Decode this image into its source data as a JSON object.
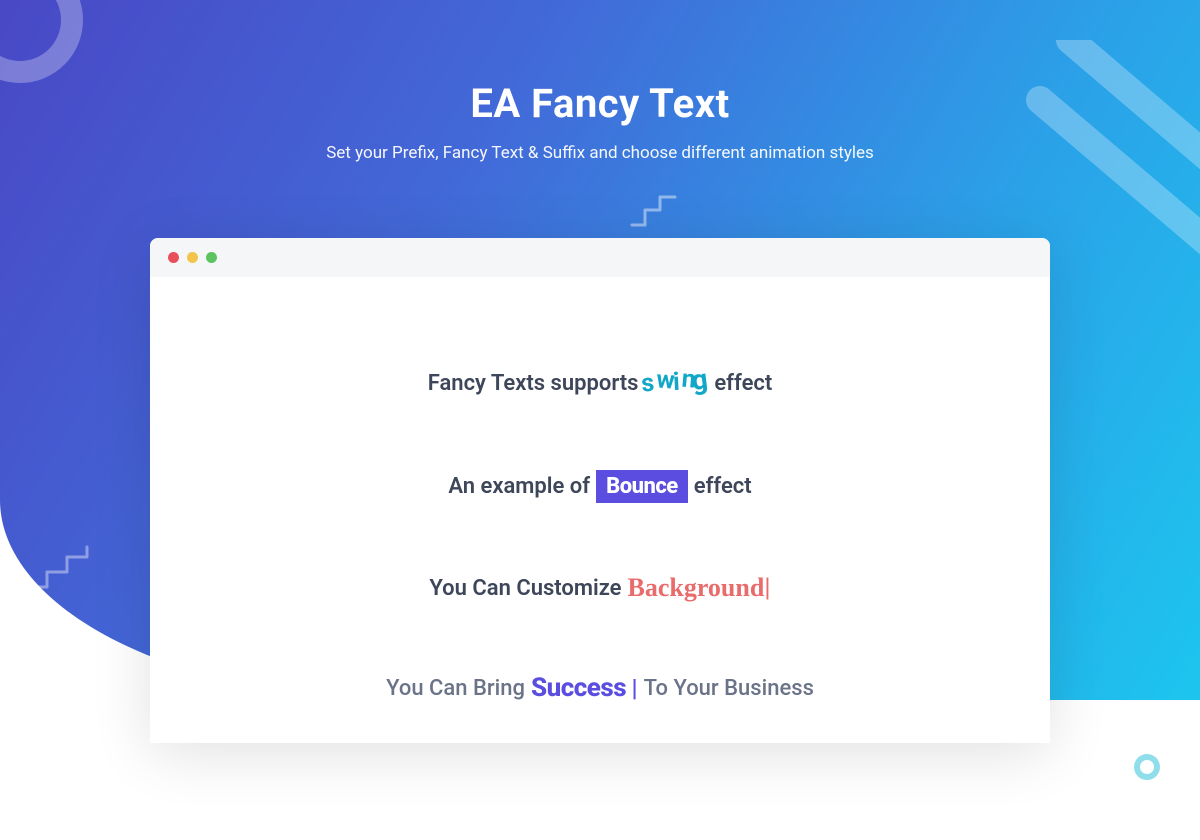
{
  "header": {
    "title": "EA Fancy Text",
    "subtitle": "Set your Prefix, Fancy Text & Suffix and choose different animation styles"
  },
  "examples": {
    "line1": {
      "prefix": "Fancy Texts supports",
      "fancy": "swing",
      "suffix": "effect"
    },
    "line2": {
      "prefix": "An example of",
      "fancy": "Bounce",
      "suffix": "effect"
    },
    "line3": {
      "prefix": "You Can Customize",
      "fancy": "Background",
      "cursor": "|"
    },
    "line4": {
      "prefix": "You Can Bring",
      "fancy": "Success",
      "cursor": "|",
      "suffix": "To Your Business"
    }
  },
  "colors": {
    "gradientStart": "#4948c5",
    "gradientEnd": "#1dc5ee",
    "swing": "#12a7c8",
    "bounce": "#5a4de0",
    "background": "#e96b6b",
    "success": "#5a4de0",
    "bodyText": "#3e465a"
  }
}
